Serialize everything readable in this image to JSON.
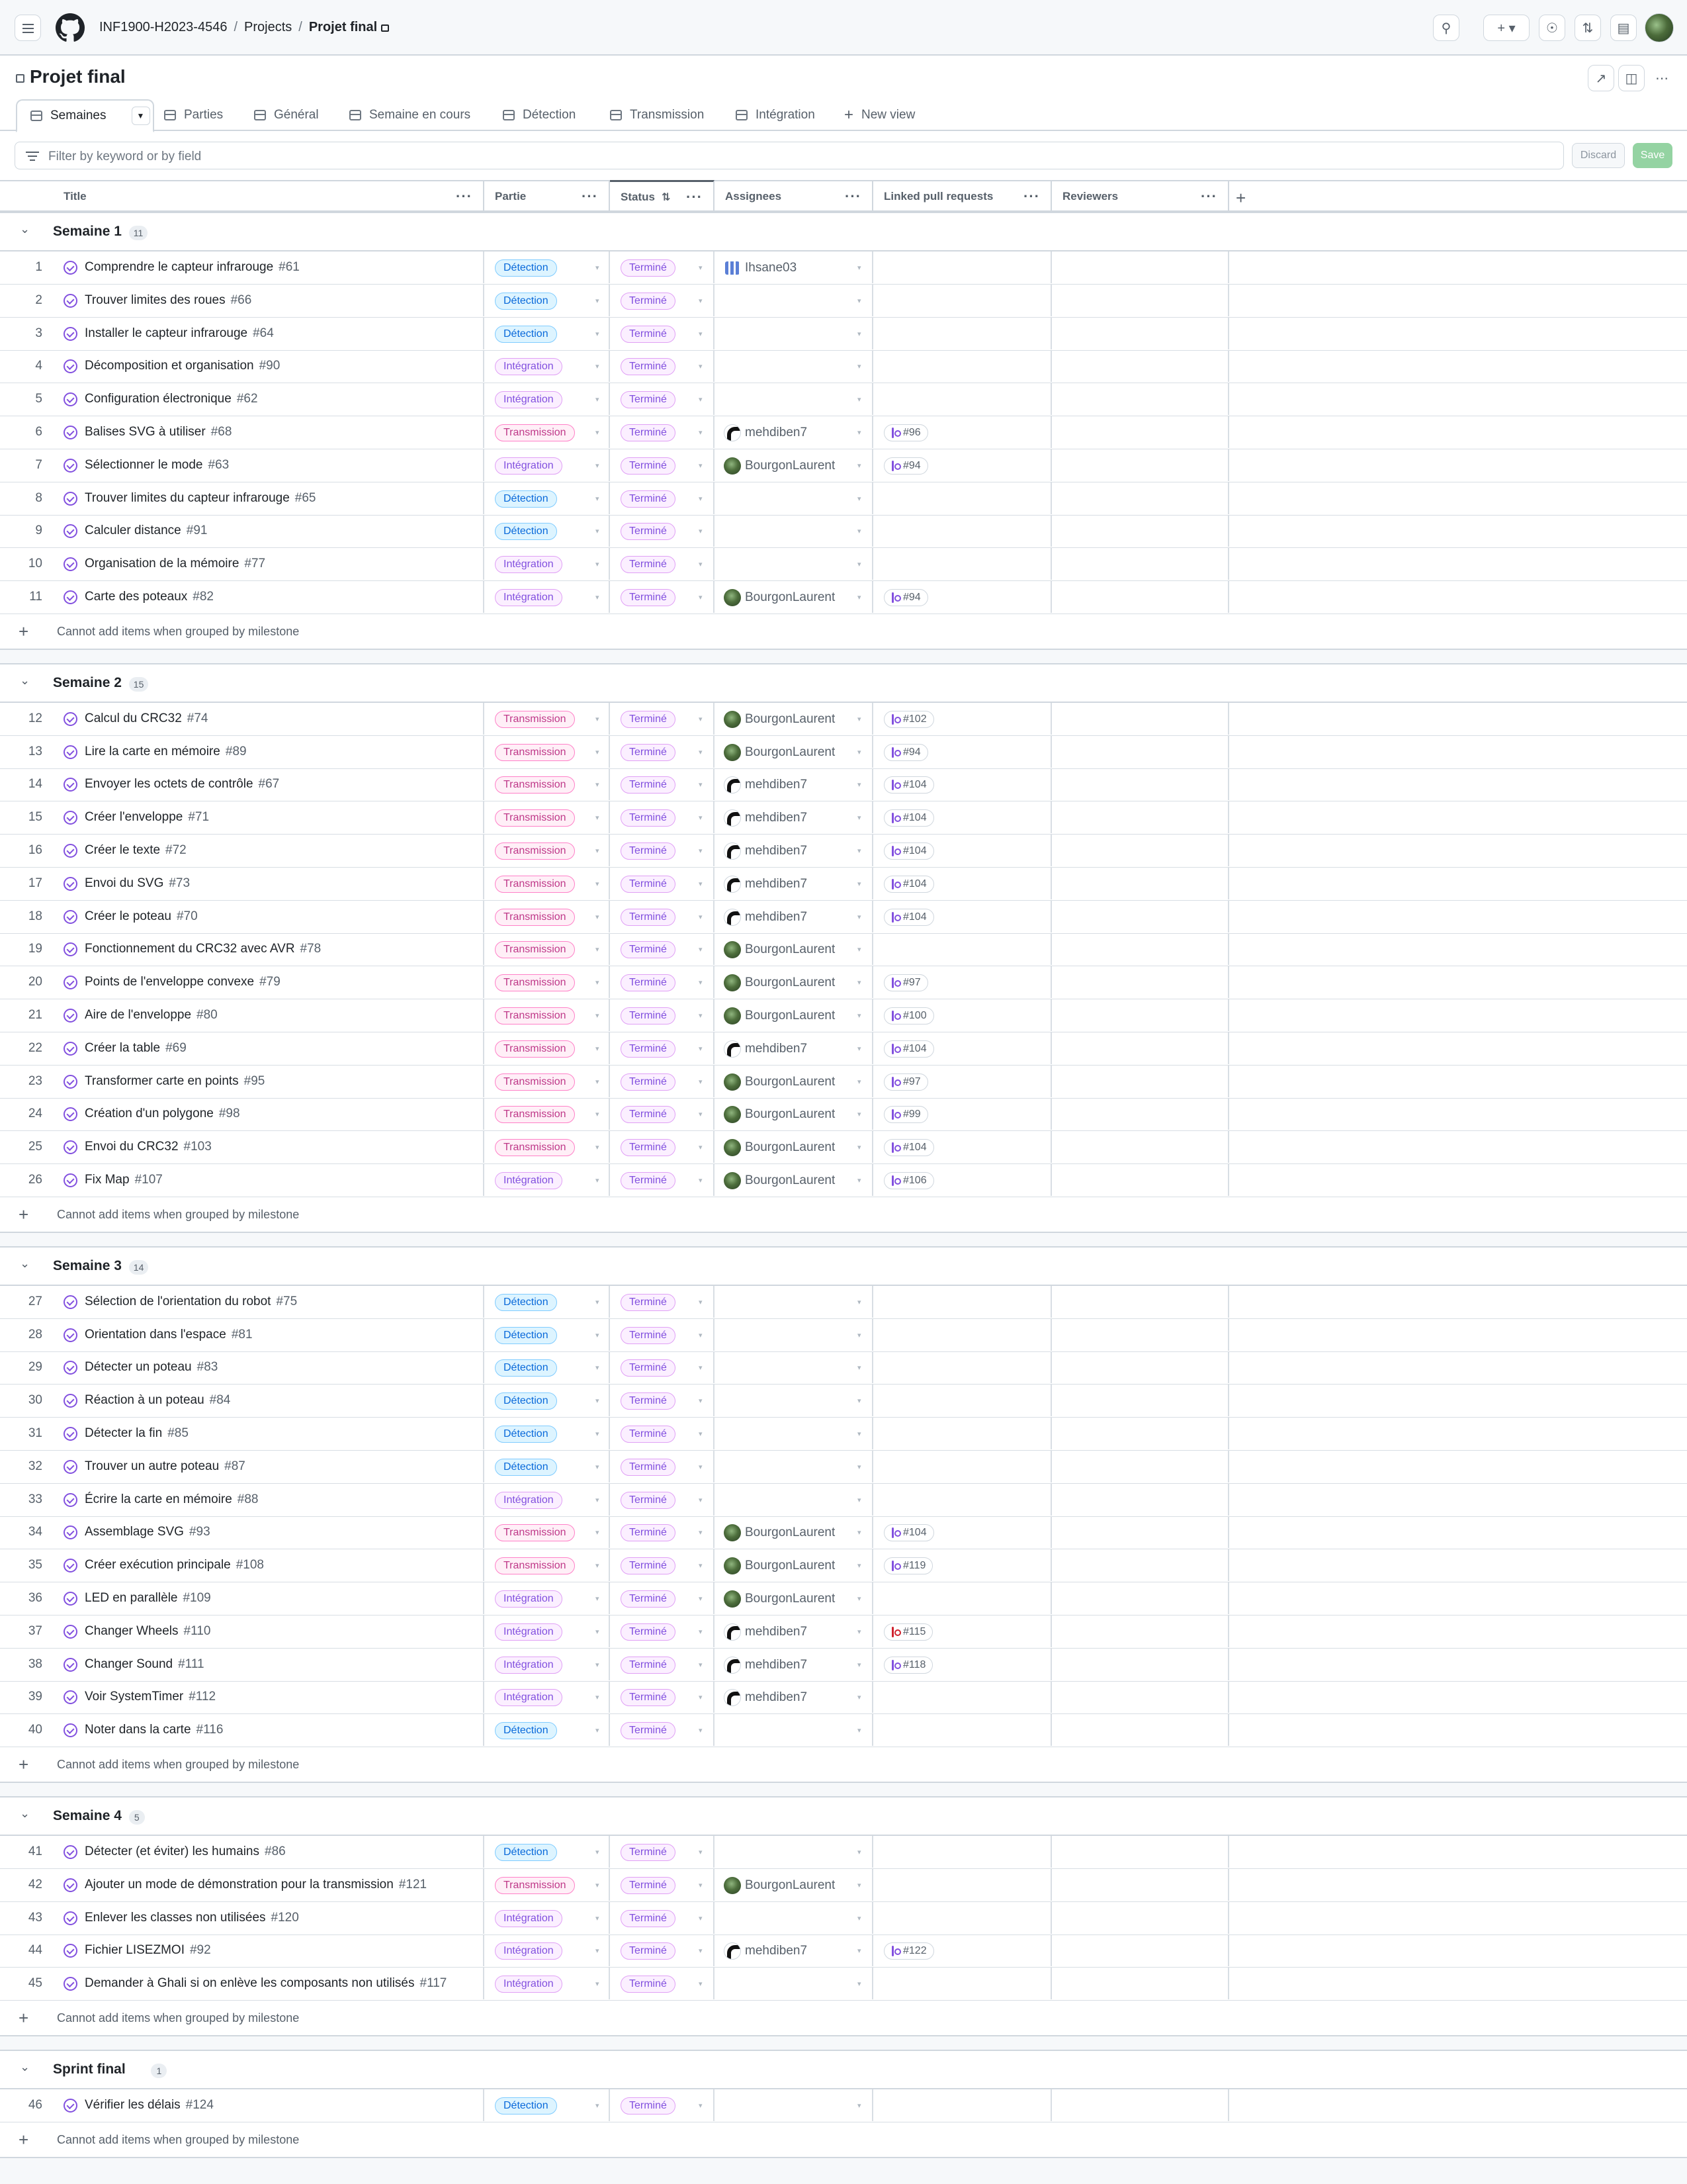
{
  "header": {
    "breadcrumb": [
      "INF1900-H2023-4546",
      "Projects",
      "Projet final"
    ],
    "icons": [
      "menu-icon",
      "github-logo",
      "search-icon",
      "plus-icon",
      "issues-icon",
      "pull-requests-icon",
      "inbox-icon"
    ]
  },
  "project": {
    "title": "Projet final"
  },
  "views": [
    {
      "label": "Semaines",
      "active": true
    },
    {
      "label": "Parties"
    },
    {
      "label": "Général"
    },
    {
      "label": "Semaine en cours"
    },
    {
      "label": "Détection"
    },
    {
      "label": "Transmission"
    },
    {
      "label": "Intégration"
    },
    {
      "label": "New view"
    }
  ],
  "filter": {
    "placeholder": "Filter by keyword or by field",
    "discard_label": "Discard",
    "save_label": "Save"
  },
  "columns": [
    "Title",
    "Partie",
    "Status",
    "Assignees",
    "Linked pull requests",
    "Reviewers"
  ],
  "add_item_message": "Cannot add items when grouped by milestone",
  "colors": {
    "detection": "#0969da",
    "transmission": "#bf3989",
    "integration": "#8250df",
    "status": "#8250df"
  },
  "groups": [
    {
      "name": "Semaine 1",
      "count": "11",
      "rows": [
        {
          "n": "1",
          "title": "Comprendre le capteur infrarouge",
          "num": "#61",
          "partie": "Détection",
          "status": "Terminé",
          "assignee": "Ihsane03",
          "av": "i",
          "pr": ""
        },
        {
          "n": "2",
          "title": "Trouver limites des roues",
          "num": "#66",
          "partie": "Détection",
          "status": "Terminé",
          "assignee": "",
          "av": "",
          "pr": ""
        },
        {
          "n": "3",
          "title": "Installer le capteur infrarouge",
          "num": "#64",
          "partie": "Détection",
          "status": "Terminé",
          "assignee": "",
          "av": "",
          "pr": ""
        },
        {
          "n": "4",
          "title": "Décomposition et organisation",
          "num": "#90",
          "partie": "Intégration",
          "status": "Terminé",
          "assignee": "",
          "av": "",
          "pr": ""
        },
        {
          "n": "5",
          "title": "Configuration électronique",
          "num": "#62",
          "partie": "Intégration",
          "status": "Terminé",
          "assignee": "",
          "av": "",
          "pr": ""
        },
        {
          "n": "6",
          "title": "Balises SVG à utiliser",
          "num": "#68",
          "partie": "Transmission",
          "status": "Terminé",
          "assignee": "mehdiben7",
          "av": "m",
          "pr": "#96"
        },
        {
          "n": "7",
          "title": "Sélectionner le mode",
          "num": "#63",
          "partie": "Intégration",
          "status": "Terminé",
          "assignee": "BourgonLaurent",
          "av": "l",
          "pr": "#94"
        },
        {
          "n": "8",
          "title": "Trouver limites du capteur infrarouge",
          "num": "#65",
          "partie": "Détection",
          "status": "Terminé",
          "assignee": "",
          "av": "",
          "pr": ""
        },
        {
          "n": "9",
          "title": "Calculer distance",
          "num": "#91",
          "partie": "Détection",
          "status": "Terminé",
          "assignee": "",
          "av": "",
          "pr": ""
        },
        {
          "n": "10",
          "title": "Organisation de la mémoire",
          "num": "#77",
          "partie": "Intégration",
          "status": "Terminé",
          "assignee": "",
          "av": "",
          "pr": ""
        },
        {
          "n": "11",
          "title": "Carte des poteaux",
          "num": "#82",
          "partie": "Intégration",
          "status": "Terminé",
          "assignee": "BourgonLaurent",
          "av": "l",
          "pr": "#94"
        }
      ]
    },
    {
      "name": "Semaine 2",
      "count": "15",
      "rows": [
        {
          "n": "12",
          "title": "Calcul du CRC32",
          "num": "#74",
          "partie": "Transmission",
          "status": "Terminé",
          "assignee": "BourgonLaurent",
          "av": "l",
          "pr": "#102"
        },
        {
          "n": "13",
          "title": "Lire la carte en mémoire",
          "num": "#89",
          "partie": "Transmission",
          "status": "Terminé",
          "assignee": "BourgonLaurent",
          "av": "l",
          "pr": "#94"
        },
        {
          "n": "14",
          "title": "Envoyer les octets de contrôle",
          "num": "#67",
          "partie": "Transmission",
          "status": "Terminé",
          "assignee": "mehdiben7",
          "av": "m",
          "pr": "#104"
        },
        {
          "n": "15",
          "title": "Créer l'enveloppe",
          "num": "#71",
          "partie": "Transmission",
          "status": "Terminé",
          "assignee": "mehdiben7",
          "av": "m",
          "pr": "#104"
        },
        {
          "n": "16",
          "title": "Créer le texte",
          "num": "#72",
          "partie": "Transmission",
          "status": "Terminé",
          "assignee": "mehdiben7",
          "av": "m",
          "pr": "#104"
        },
        {
          "n": "17",
          "title": "Envoi du SVG",
          "num": "#73",
          "partie": "Transmission",
          "status": "Terminé",
          "assignee": "mehdiben7",
          "av": "m",
          "pr": "#104"
        },
        {
          "n": "18",
          "title": "Créer le poteau",
          "num": "#70",
          "partie": "Transmission",
          "status": "Terminé",
          "assignee": "mehdiben7",
          "av": "m",
          "pr": "#104"
        },
        {
          "n": "19",
          "title": "Fonctionnement du CRC32 avec AVR",
          "num": "#78",
          "partie": "Transmission",
          "status": "Terminé",
          "assignee": "BourgonLaurent",
          "av": "l",
          "pr": ""
        },
        {
          "n": "20",
          "title": "Points de l'enveloppe convexe",
          "num": "#79",
          "partie": "Transmission",
          "status": "Terminé",
          "assignee": "BourgonLaurent",
          "av": "l",
          "pr": "#97"
        },
        {
          "n": "21",
          "title": "Aire de l'enveloppe",
          "num": "#80",
          "partie": "Transmission",
          "status": "Terminé",
          "assignee": "BourgonLaurent",
          "av": "l",
          "pr": "#100"
        },
        {
          "n": "22",
          "title": "Créer la table",
          "num": "#69",
          "partie": "Transmission",
          "status": "Terminé",
          "assignee": "mehdiben7",
          "av": "m",
          "pr": "#104"
        },
        {
          "n": "23",
          "title": "Transformer carte en points",
          "num": "#95",
          "partie": "Transmission",
          "status": "Terminé",
          "assignee": "BourgonLaurent",
          "av": "l",
          "pr": "#97"
        },
        {
          "n": "24",
          "title": "Création d'un polygone",
          "num": "#98",
          "partie": "Transmission",
          "status": "Terminé",
          "assignee": "BourgonLaurent",
          "av": "l",
          "pr": "#99"
        },
        {
          "n": "25",
          "title": "Envoi du CRC32",
          "num": "#103",
          "partie": "Transmission",
          "status": "Terminé",
          "assignee": "BourgonLaurent",
          "av": "l",
          "pr": "#104"
        },
        {
          "n": "26",
          "title": "Fix Map",
          "num": "#107",
          "partie": "Intégration",
          "status": "Terminé",
          "assignee": "BourgonLaurent",
          "av": "l",
          "pr": "#106"
        }
      ]
    },
    {
      "name": "Semaine 3",
      "count": "14",
      "rows": [
        {
          "n": "27",
          "title": "Sélection de l'orientation du robot",
          "num": "#75",
          "partie": "Détection",
          "status": "Terminé",
          "assignee": "",
          "av": "",
          "pr": ""
        },
        {
          "n": "28",
          "title": "Orientation dans l'espace",
          "num": "#81",
          "partie": "Détection",
          "status": "Terminé",
          "assignee": "",
          "av": "",
          "pr": ""
        },
        {
          "n": "29",
          "title": "Détecter un poteau",
          "num": "#83",
          "partie": "Détection",
          "status": "Terminé",
          "assignee": "",
          "av": "",
          "pr": ""
        },
        {
          "n": "30",
          "title": "Réaction à un poteau",
          "num": "#84",
          "partie": "Détection",
          "status": "Terminé",
          "assignee": "",
          "av": "",
          "pr": ""
        },
        {
          "n": "31",
          "title": "Détecter la fin",
          "num": "#85",
          "partie": "Détection",
          "status": "Terminé",
          "assignee": "",
          "av": "",
          "pr": ""
        },
        {
          "n": "32",
          "title": "Trouver un autre poteau",
          "num": "#87",
          "partie": "Détection",
          "status": "Terminé",
          "assignee": "",
          "av": "",
          "pr": ""
        },
        {
          "n": "33",
          "title": "Écrire la carte en mémoire",
          "num": "#88",
          "partie": "Intégration",
          "status": "Terminé",
          "assignee": "",
          "av": "",
          "pr": ""
        },
        {
          "n": "34",
          "title": "Assemblage SVG",
          "num": "#93",
          "partie": "Transmission",
          "status": "Terminé",
          "assignee": "BourgonLaurent",
          "av": "l",
          "pr": "#104"
        },
        {
          "n": "35",
          "title": "Créer exécution principale",
          "num": "#108",
          "partie": "Transmission",
          "status": "Terminé",
          "assignee": "BourgonLaurent",
          "av": "l",
          "pr": "#119"
        },
        {
          "n": "36",
          "title": "LED en parallèle",
          "num": "#109",
          "partie": "Intégration",
          "status": "Terminé",
          "assignee": "BourgonLaurent",
          "av": "l",
          "pr": ""
        },
        {
          "n": "37",
          "title": "Changer Wheels",
          "num": "#110",
          "partie": "Intégration",
          "status": "Terminé",
          "assignee": "mehdiben7",
          "av": "m",
          "pr": "#115",
          "pr_closed": true
        },
        {
          "n": "38",
          "title": "Changer Sound",
          "num": "#111",
          "partie": "Intégration",
          "status": "Terminé",
          "assignee": "mehdiben7",
          "av": "m",
          "pr": "#118"
        },
        {
          "n": "39",
          "title": "Voir SystemTimer",
          "num": "#112",
          "partie": "Intégration",
          "status": "Terminé",
          "assignee": "mehdiben7",
          "av": "m",
          "pr": ""
        },
        {
          "n": "40",
          "title": "Noter dans la carte",
          "num": "#116",
          "partie": "Détection",
          "status": "Terminé",
          "assignee": "",
          "av": "",
          "pr": ""
        }
      ]
    },
    {
      "name": "Semaine 4",
      "count": "5",
      "rows": [
        {
          "n": "41",
          "title": "Détecter (et éviter) les humains",
          "num": "#86",
          "partie": "Détection",
          "status": "Terminé",
          "assignee": "",
          "av": "",
          "pr": ""
        },
        {
          "n": "42",
          "title": "Ajouter un mode de démonstration pour la transmission",
          "num": "#121",
          "partie": "Transmission",
          "status": "Terminé",
          "assignee": "BourgonLaurent",
          "av": "l",
          "pr": ""
        },
        {
          "n": "43",
          "title": "Enlever les classes non utilisées",
          "num": "#120",
          "partie": "Intégration",
          "status": "Terminé",
          "assignee": "",
          "av": "",
          "pr": ""
        },
        {
          "n": "44",
          "title": "Fichier LISEZMOI",
          "num": "#92",
          "partie": "Intégration",
          "status": "Terminé",
          "assignee": "mehdiben7",
          "av": "m",
          "pr": "#122"
        },
        {
          "n": "45",
          "title": "Demander à Ghali si on enlève les composants non utilisés",
          "num": "#117",
          "partie": "Intégration",
          "status": "Terminé",
          "assignee": "",
          "av": "",
          "pr": ""
        }
      ]
    },
    {
      "name": "Sprint final",
      "count": "1",
      "rows": [
        {
          "n": "46",
          "title": "Vérifier les délais",
          "num": "#124",
          "partie": "Détection",
          "status": "Terminé",
          "assignee": "",
          "av": "",
          "pr": ""
        }
      ]
    }
  ]
}
